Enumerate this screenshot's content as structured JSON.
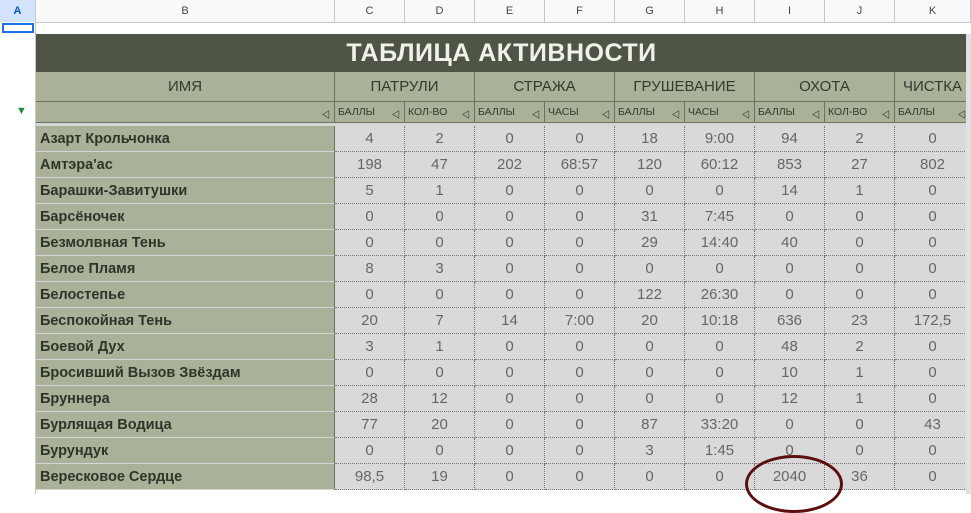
{
  "sheet": {
    "columns": [
      "A",
      "B",
      "C",
      "D",
      "E",
      "F",
      "G",
      "H",
      "I",
      "J",
      "K"
    ],
    "selected_column": "A",
    "title": "ТАБЛИЦА АКТИВНОСТИ",
    "name_header": "ИМЯ",
    "groups": [
      "ПАТРУЛИ",
      "СТРАЖА",
      "ГРУШЕВАНИЕ",
      "ОХОТА",
      "ЧИСТКА"
    ],
    "subheaders": [
      "БАЛЛЫ",
      "КОЛ-ВО",
      "БАЛЛЫ",
      "ЧАСЫ",
      "БАЛЛЫ",
      "ЧАСЫ",
      "БАЛЛЫ",
      "КОЛ-ВО",
      "БАЛЛЫ"
    ],
    "filter_icon": "filter-icon",
    "rows": [
      {
        "name": "Азарт Крольчонка",
        "values": [
          "4",
          "2",
          "0",
          "0",
          "18",
          "9:00",
          "94",
          "2",
          "0"
        ]
      },
      {
        "name": "Амтэра'ас",
        "values": [
          "198",
          "47",
          "202",
          "68:57",
          "120",
          "60:12",
          "853",
          "27",
          "802"
        ]
      },
      {
        "name": "Барашки-Завитушки",
        "values": [
          "5",
          "1",
          "0",
          "0",
          "0",
          "0",
          "14",
          "1",
          "0"
        ]
      },
      {
        "name": "Барсёночек",
        "values": [
          "0",
          "0",
          "0",
          "0",
          "31",
          "7:45",
          "0",
          "0",
          "0"
        ]
      },
      {
        "name": "Безмолвная Тень",
        "values": [
          "0",
          "0",
          "0",
          "0",
          "29",
          "14:40",
          "40",
          "0",
          "0"
        ]
      },
      {
        "name": "Белое Пламя",
        "values": [
          "8",
          "3",
          "0",
          "0",
          "0",
          "0",
          "0",
          "0",
          "0"
        ]
      },
      {
        "name": "Белостепье",
        "values": [
          "0",
          "0",
          "0",
          "0",
          "122",
          "26:30",
          "0",
          "0",
          "0"
        ]
      },
      {
        "name": "Беспокойная Тень",
        "values": [
          "20",
          "7",
          "14",
          "7:00",
          "20",
          "10:18",
          "636",
          "23",
          "172,5"
        ]
      },
      {
        "name": "Боевой Дух",
        "values": [
          "3",
          "1",
          "0",
          "0",
          "0",
          "0",
          "48",
          "2",
          "0"
        ]
      },
      {
        "name": "Бросивший Вызов Звёздам",
        "values": [
          "0",
          "0",
          "0",
          "0",
          "0",
          "0",
          "10",
          "1",
          "0"
        ]
      },
      {
        "name": "Бруннера",
        "values": [
          "28",
          "12",
          "0",
          "0",
          "0",
          "0",
          "12",
          "1",
          "0"
        ]
      },
      {
        "name": "Бурлящая Водица",
        "values": [
          "77",
          "20",
          "0",
          "0",
          "87",
          "33:20",
          "0",
          "0",
          "43"
        ]
      },
      {
        "name": "Бурундук",
        "values": [
          "0",
          "0",
          "0",
          "0",
          "3",
          "1:45",
          "0",
          "0",
          "0"
        ]
      },
      {
        "name": "Вересковое Сердце",
        "values": [
          "98,5",
          "19",
          "0",
          "0",
          "0",
          "0",
          "2040",
          "36",
          "0"
        ]
      }
    ]
  }
}
